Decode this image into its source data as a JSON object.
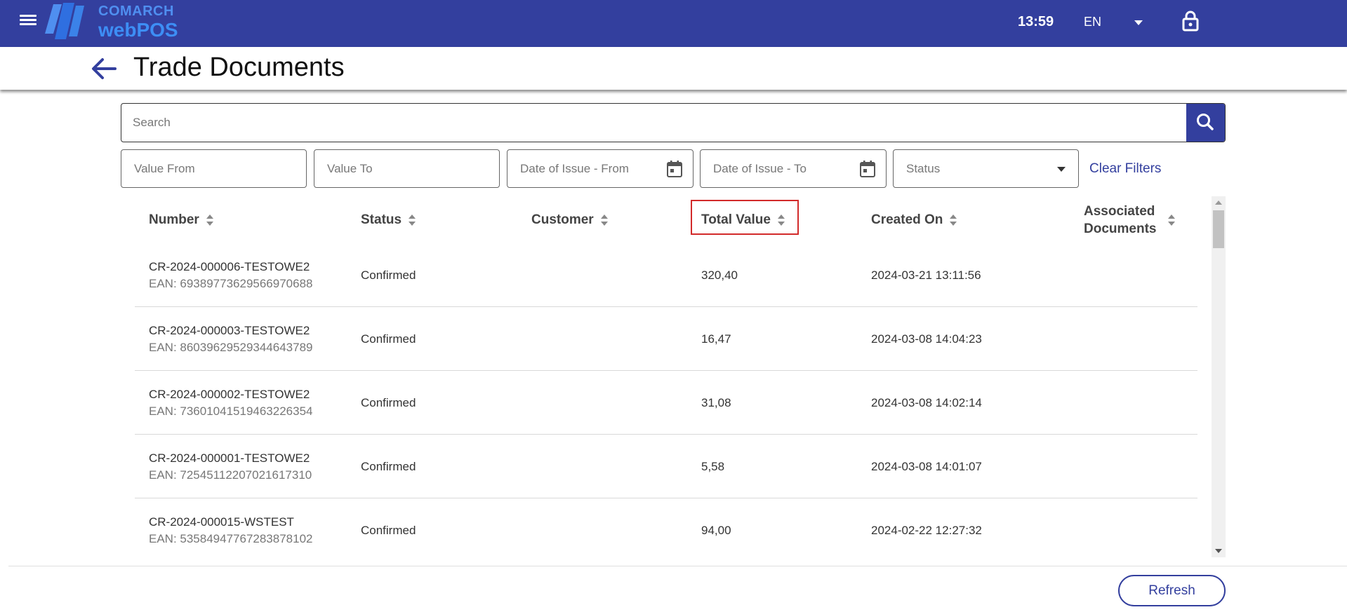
{
  "header": {
    "brand_line1": "COMARCH",
    "brand_line2": "webPOS",
    "time": "13:59",
    "language": "EN",
    "bar_color": "#333f9e",
    "accent_color": "#3d8ef5"
  },
  "page": {
    "title": "Trade Documents"
  },
  "search": {
    "placeholder": "Search"
  },
  "filters": {
    "value_from_placeholder": "Value From",
    "value_to_placeholder": "Value To",
    "date_from_placeholder": "Date of Issue - From",
    "date_to_placeholder": "Date of Issue - To",
    "status_placeholder": "Status",
    "clear_label": "Clear Filters"
  },
  "table": {
    "columns": {
      "number": "Number",
      "status": "Status",
      "customer": "Customer",
      "total_value": "Total Value",
      "created_on": "Created On",
      "associated": "Associated Documents"
    },
    "rows": [
      {
        "number": "CR-2024-000006-TESTOWE2",
        "ean": "EAN: 69389773629566970688",
        "status": "Confirmed",
        "customer": "",
        "total": "320,40",
        "created": "2024-03-21 13:11:56",
        "associated": ""
      },
      {
        "number": "CR-2024-000003-TESTOWE2",
        "ean": "EAN: 86039629529344643789",
        "status": "Confirmed",
        "customer": "",
        "total": "16,47",
        "created": "2024-03-08 14:04:23",
        "associated": ""
      },
      {
        "number": "CR-2024-000002-TESTOWE2",
        "ean": "EAN: 73601041519463226354",
        "status": "Confirmed",
        "customer": "",
        "total": "31,08",
        "created": "2024-03-08 14:02:14",
        "associated": ""
      },
      {
        "number": "CR-2024-000001-TESTOWE2",
        "ean": "EAN: 72545112207021617310",
        "status": "Confirmed",
        "customer": "",
        "total": "5,58",
        "created": "2024-03-08 14:01:07",
        "associated": ""
      },
      {
        "number": "CR-2024-000015-WSTEST",
        "ean": "EAN: 53584947767283878102",
        "status": "Confirmed",
        "customer": "",
        "total": "94,00",
        "created": "2024-02-22 12:27:32",
        "associated": ""
      }
    ]
  },
  "footer": {
    "refresh_label": "Refresh"
  }
}
